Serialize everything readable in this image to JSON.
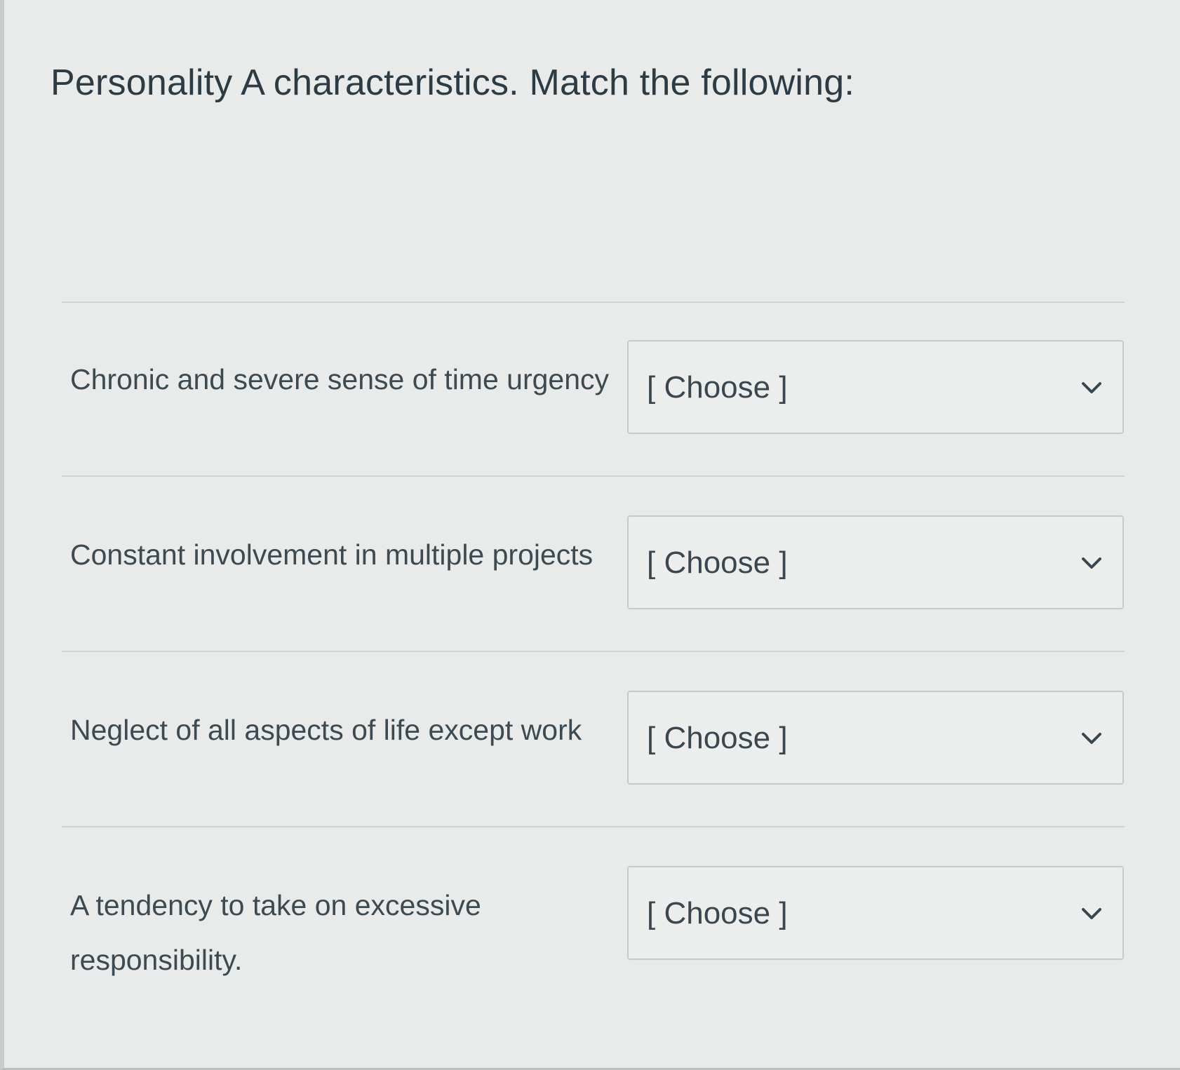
{
  "question": {
    "text": "Personality A characteristics. Match the following:"
  },
  "matches": [
    {
      "prompt": "Chronic and severe sense of time urgency",
      "selected": "[ Choose ]"
    },
    {
      "prompt": "Constant involvement in multiple projects",
      "selected": "[ Choose ]"
    },
    {
      "prompt": "Neglect of all aspects of life except work",
      "selected": "[ Choose ]"
    },
    {
      "prompt": "A tendency to take on excessive responsibility.",
      "selected": "[ Choose ]"
    }
  ],
  "icons": {
    "dropdown": "chevron-down-icon"
  }
}
